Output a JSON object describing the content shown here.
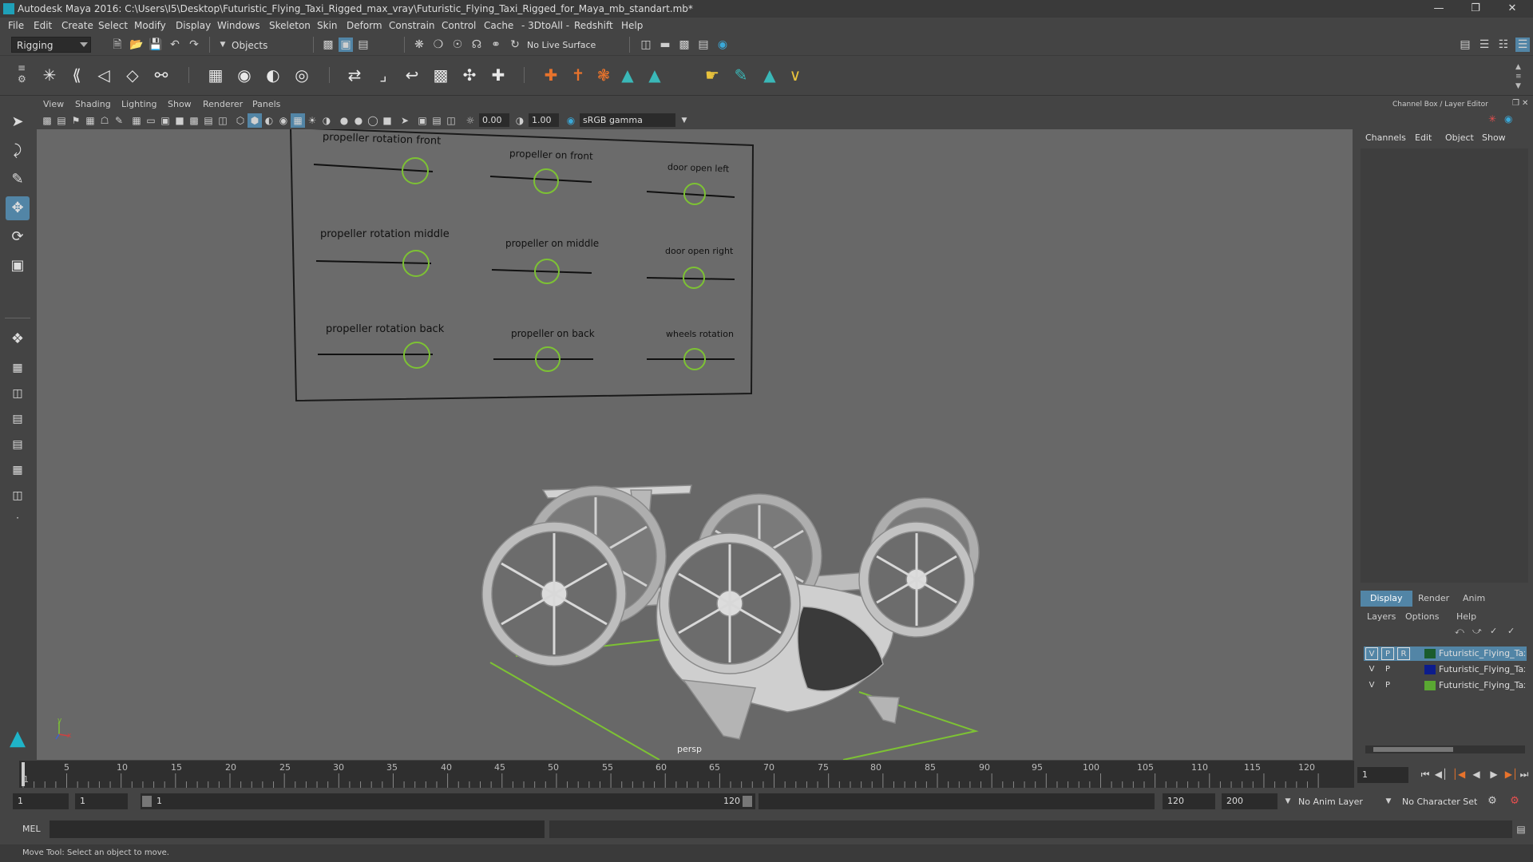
{
  "window": {
    "title": "Autodesk Maya 2016: C:\\Users\\I5\\Desktop\\Futuristic_Flying_Taxi_Rigged_max_vray\\Futuristic_Flying_Taxi_Rigged_for_Maya_mb_standart.mb*",
    "min_icon": "minimize-icon",
    "max_icon": "maximize-icon",
    "close_icon": "close-icon"
  },
  "menubar": [
    "File",
    "Edit",
    "Create",
    "Select",
    "Modify",
    "Display",
    "Windows",
    "Skeleton",
    "Skin",
    "Deform",
    "Constrain",
    "Control",
    "Cache",
    "- 3DtoAll -",
    "Redshift",
    "Help"
  ],
  "statusline": {
    "mode": "Rigging",
    "selection_mode": "Objects",
    "live_surface": "No Live Surface"
  },
  "panel": {
    "menus": [
      "View",
      "Shading",
      "Lighting",
      "Show",
      "Renderer",
      "Panels"
    ],
    "exposure": "0.00",
    "gamma": "1.00",
    "color_space": "sRGB gamma"
  },
  "viewport": {
    "camera": "persp",
    "axis_y": "y",
    "axis_x": "x",
    "controls": [
      "propeller rotation front",
      "propeller on front",
      "door open left",
      "propeller rotation middle",
      "propeller on middle",
      "door open right",
      "propeller rotation back",
      "propeller on back",
      "wheels rotation"
    ]
  },
  "channelbox": {
    "title": "Channel Box / Layer Editor",
    "menus": [
      "Channels",
      "Edit",
      "Object",
      "Show"
    ],
    "tabs": [
      "Display",
      "Render",
      "Anim"
    ],
    "layer_menus": [
      "Layers",
      "Options",
      "Help"
    ],
    "layers": [
      {
        "v": "V",
        "p": "P",
        "r": "R",
        "color": "#1a5c2c",
        "name": "Futuristic_Flying_Taxi_",
        "selected": true
      },
      {
        "v": "V",
        "p": "P",
        "r": "",
        "color": "#0c1c8c",
        "name": "Futuristic_Flying_Taxi_",
        "selected": false
      },
      {
        "v": "V",
        "p": "P",
        "r": "",
        "color": "#5aa832",
        "name": "Futuristic_Flying_Taxi_",
        "selected": false
      }
    ]
  },
  "timeline": {
    "ticks": [
      "1",
      "5",
      "10",
      "15",
      "20",
      "25",
      "30",
      "35",
      "40",
      "45",
      "50",
      "55",
      "60",
      "65",
      "70",
      "75",
      "80",
      "85",
      "90",
      "95",
      "100",
      "105",
      "110",
      "115",
      "120"
    ],
    "current_frame": "1"
  },
  "range": {
    "start": "1",
    "anim_start": "1",
    "slider_start": "1",
    "slider_end": "120",
    "end": "120",
    "anim_end": "200",
    "anim_layer": "No Anim Layer",
    "character_set": "No Character Set"
  },
  "cmdline": {
    "label": "MEL"
  },
  "helpline": {
    "text": "Move Tool: Select an object to move."
  }
}
